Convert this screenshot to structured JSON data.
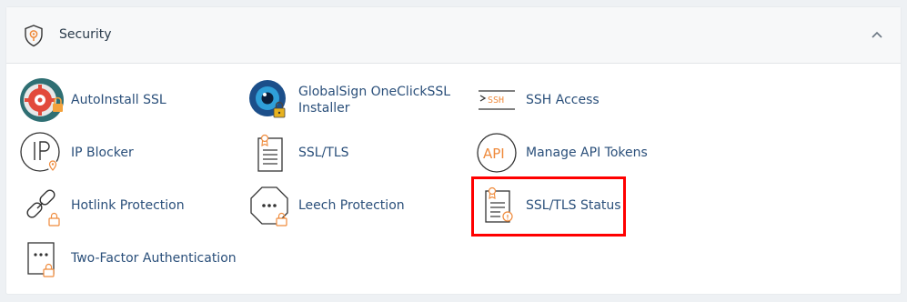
{
  "section": {
    "title": "Security",
    "header_icon": "shield-icon",
    "collapse_icon": "chevron-up-icon"
  },
  "items": [
    {
      "label": "AutoInstall SSL",
      "icon": "autoinstall-ssl-icon"
    },
    {
      "label": "GlobalSign OneClickSSL Installer",
      "icon": "globalsign-icon"
    },
    {
      "label": "SSH Access",
      "icon": "ssh-icon"
    },
    {
      "label": "IP Blocker",
      "icon": "ip-blocker-icon"
    },
    {
      "label": "SSL/TLS",
      "icon": "certificate-icon"
    },
    {
      "label": "Manage API Tokens",
      "icon": "api-icon"
    },
    {
      "label": "Hotlink Protection",
      "icon": "hotlink-icon"
    },
    {
      "label": "Leech Protection",
      "icon": "leech-icon"
    },
    {
      "label": "SSL/TLS Status",
      "icon": "ssl-status-icon"
    },
    {
      "label": "Two-Factor Authentication",
      "icon": "two-factor-icon"
    }
  ],
  "colors": {
    "accent": "#ef8a3b",
    "link": "#2a4f7a",
    "highlight": "#ff0000"
  }
}
